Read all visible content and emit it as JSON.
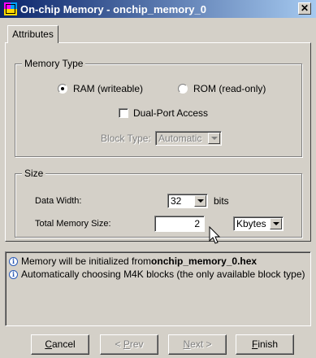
{
  "window": {
    "title": "On-chip Memory - onchip_memory_0",
    "close_glyph": "✕"
  },
  "tabs": [
    {
      "label": "Attributes",
      "active": true
    }
  ],
  "memory_type": {
    "legend": "Memory Type",
    "ram_label": "RAM (writeable)",
    "rom_label": "ROM (read-only)",
    "selected": "RAM (writeable)",
    "dual_port_label": "Dual-Port Access",
    "dual_port_checked": false,
    "block_type_label": "Block Type:",
    "block_type_value": "Automatic"
  },
  "size": {
    "legend": "Size",
    "data_width_label": "Data Width:",
    "data_width_value": "32",
    "data_width_unit": "bits",
    "total_size_label": "Total Memory Size:",
    "total_size_value": "2",
    "total_size_unit": "Kbytes"
  },
  "messages": [
    {
      "icon": "info-icon",
      "prefix": "Memory will be initialized from ",
      "bold": "onchip_memory_0.hex"
    },
    {
      "icon": "info-icon",
      "prefix": "Automatically choosing M4K blocks (the only available block type)",
      "bold": ""
    }
  ],
  "buttons": {
    "cancel_u": "C",
    "cancel_rest": "ancel",
    "prev_pre": "< ",
    "prev_u": "P",
    "prev_rest": "rev",
    "next_u": "N",
    "next_rest": "ext >",
    "finish_u": "F",
    "finish_rest": "inish"
  },
  "colors": {
    "titlebar_start": "#0a246a",
    "titlebar_end": "#a6caf0",
    "face": "#d4d0c8"
  }
}
